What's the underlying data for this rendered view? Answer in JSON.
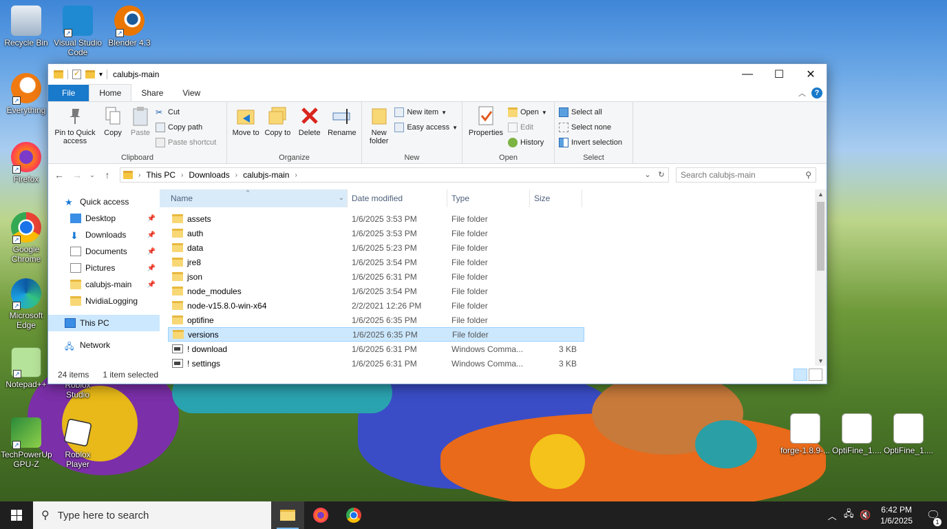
{
  "desktop": {
    "icons_left": [
      {
        "label": "Recycle Bin",
        "icon": "recycle-bin-icon"
      },
      {
        "label": "Visual Studio Code",
        "icon": "vscode-icon"
      },
      {
        "label": "Blender 4.3",
        "icon": "blender-icon"
      },
      {
        "label": "Everything",
        "icon": "everything-search-icon"
      },
      {
        "label": "Firefox",
        "icon": "firefox-icon"
      },
      {
        "label": "Google Chrome",
        "icon": "chrome-icon"
      },
      {
        "label": "Microsoft Edge",
        "icon": "edge-icon"
      },
      {
        "label": "Notepad++",
        "icon": "notepadpp-icon"
      },
      {
        "label": "Roblox Studio",
        "icon": "roblox-studio-icon"
      },
      {
        "label": "TechPowerUp GPU-Z",
        "icon": "gpuz-icon"
      },
      {
        "label": "Roblox Player",
        "icon": "roblox-player-icon"
      }
    ],
    "icons_right": [
      {
        "label": "forge-1.8.9-...",
        "icon": "java-icon"
      },
      {
        "label": "OptiFine_1....",
        "icon": "java-icon"
      },
      {
        "label": "OptiFine_1....",
        "icon": "java-icon"
      }
    ]
  },
  "window": {
    "title": "calubjs-main",
    "controls": {
      "minimize": "—",
      "maximize": "☐",
      "close": "✕"
    },
    "tabs": [
      "File",
      "Home",
      "Share",
      "View"
    ],
    "active_tab": "Home",
    "ribbon": {
      "clipboard": {
        "label": "Clipboard",
        "pin": "Pin to Quick access",
        "copy": "Copy",
        "paste": "Paste",
        "cut": "Cut",
        "copy_path": "Copy path",
        "paste_shortcut": "Paste shortcut"
      },
      "organize": {
        "label": "Organize",
        "move_to": "Move to",
        "copy_to": "Copy to",
        "delete": "Delete",
        "rename": "Rename"
      },
      "new": {
        "label": "New",
        "new_folder": "New folder",
        "new_item": "New item",
        "easy_access": "Easy access"
      },
      "open": {
        "label": "Open",
        "properties": "Properties",
        "open": "Open",
        "edit": "Edit",
        "history": "History"
      },
      "select": {
        "label": "Select",
        "select_all": "Select all",
        "select_none": "Select none",
        "invert": "Invert selection"
      }
    },
    "address": {
      "crumbs": [
        "This PC",
        "Downloads",
        "calubjs-main"
      ],
      "search_placeholder": "Search calubjs-main"
    },
    "nav": {
      "quick_access": "Quick access",
      "pinned": [
        {
          "label": "Desktop"
        },
        {
          "label": "Downloads"
        },
        {
          "label": "Documents"
        },
        {
          "label": "Pictures"
        },
        {
          "label": "calubjs-main"
        }
      ],
      "unpinned": "NvidiaLogging",
      "this_pc": "This PC",
      "network": "Network"
    },
    "columns": {
      "name": "Name",
      "date": "Date modified",
      "type": "Type",
      "size": "Size"
    },
    "files": [
      {
        "name": "assets",
        "date": "1/6/2025 3:53 PM",
        "type": "File folder",
        "size": "",
        "kind": "folder"
      },
      {
        "name": "auth",
        "date": "1/6/2025 3:53 PM",
        "type": "File folder",
        "size": "",
        "kind": "folder"
      },
      {
        "name": "data",
        "date": "1/6/2025 5:23 PM",
        "type": "File folder",
        "size": "",
        "kind": "folder"
      },
      {
        "name": "jre8",
        "date": "1/6/2025 3:54 PM",
        "type": "File folder",
        "size": "",
        "kind": "folder"
      },
      {
        "name": "json",
        "date": "1/6/2025 6:31 PM",
        "type": "File folder",
        "size": "",
        "kind": "folder"
      },
      {
        "name": "node_modules",
        "date": "1/6/2025 3:54 PM",
        "type": "File folder",
        "size": "",
        "kind": "folder"
      },
      {
        "name": "node-v15.8.0-win-x64",
        "date": "2/2/2021 12:26 PM",
        "type": "File folder",
        "size": "",
        "kind": "folder"
      },
      {
        "name": "optifine",
        "date": "1/6/2025 6:35 PM",
        "type": "File folder",
        "size": "",
        "kind": "folder"
      },
      {
        "name": "versions",
        "date": "1/6/2025 6:35 PM",
        "type": "File folder",
        "size": "",
        "kind": "folder",
        "selected": true
      },
      {
        "name": "! download",
        "date": "1/6/2025 6:31 PM",
        "type": "Windows Comma...",
        "size": "3 KB",
        "kind": "cmd"
      },
      {
        "name": "! settings",
        "date": "1/6/2025 6:31 PM",
        "type": "Windows Comma...",
        "size": "3 KB",
        "kind": "cmd"
      }
    ],
    "status": {
      "count": "24 items",
      "selected": "1 item selected"
    }
  },
  "taskbar": {
    "search_placeholder": "Type here to search",
    "apps": [
      "file-explorer-icon",
      "firefox-icon",
      "chrome-icon"
    ],
    "time": "6:42 PM",
    "date": "1/6/2025",
    "notifications": "1"
  },
  "colors": {
    "accent": "#1979ca",
    "selection": "#cce8ff",
    "taskbar": "#1f1f1f"
  }
}
